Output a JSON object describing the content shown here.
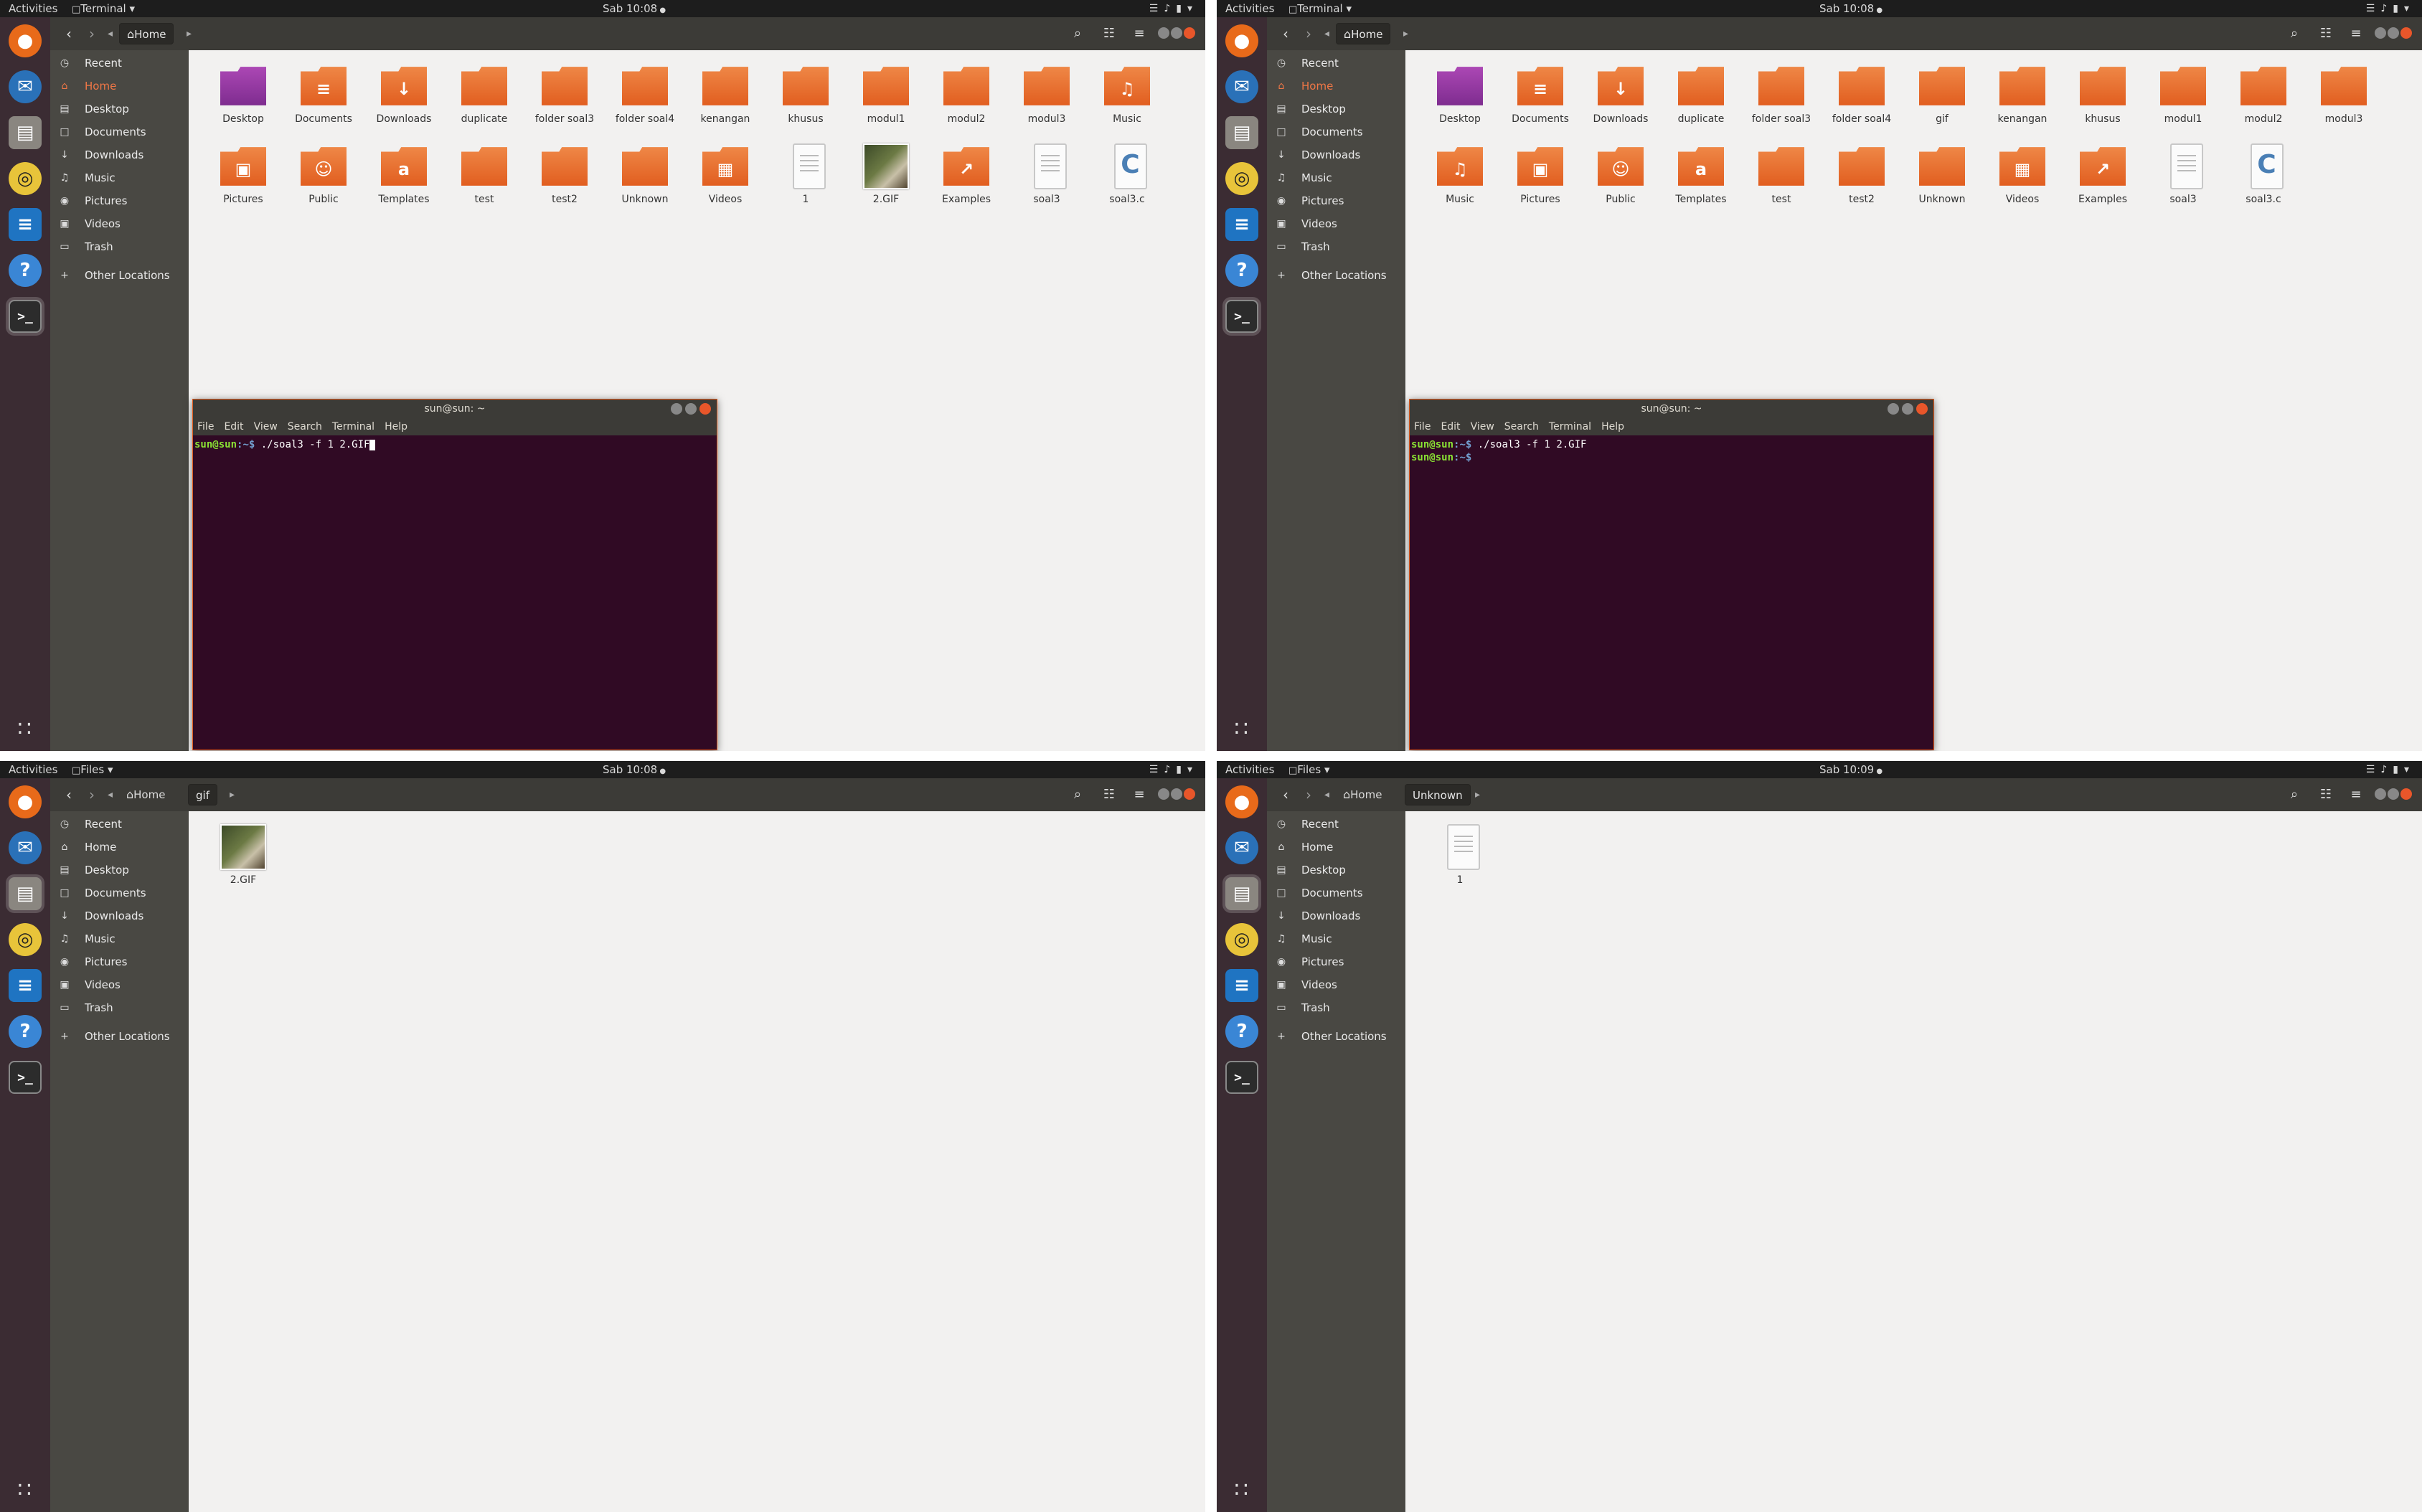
{
  "quadrants": [
    {
      "topbar": {
        "activities": "Activities",
        "app": "Terminal",
        "clock": "Sab 10:08"
      },
      "breadcrumbs": [
        "Home"
      ],
      "sidebar": [
        "Recent",
        "Home",
        "Desktop",
        "Documents",
        "Downloads",
        "Music",
        "Pictures",
        "Videos",
        "Trash",
        "Other Locations"
      ],
      "files": [
        {
          "name": "Desktop",
          "kind": "folder"
        },
        {
          "name": "Documents",
          "kind": "folder"
        },
        {
          "name": "Downloads",
          "kind": "folder"
        },
        {
          "name": "duplicate",
          "kind": "folder"
        },
        {
          "name": "folder soal3",
          "kind": "folder"
        },
        {
          "name": "folder soal4",
          "kind": "folder"
        },
        {
          "name": "kenangan",
          "kind": "folder"
        },
        {
          "name": "khusus",
          "kind": "folder"
        },
        {
          "name": "modul1",
          "kind": "folder"
        },
        {
          "name": "modul2",
          "kind": "folder"
        },
        {
          "name": "modul3",
          "kind": "folder"
        },
        {
          "name": "Music",
          "kind": "folder"
        },
        {
          "name": "Pictures",
          "kind": "folder"
        },
        {
          "name": "Public",
          "kind": "folder"
        },
        {
          "name": "Templates",
          "kind": "folder"
        },
        {
          "name": "test",
          "kind": "folder"
        },
        {
          "name": "test2",
          "kind": "folder"
        },
        {
          "name": "Unknown",
          "kind": "folder"
        },
        {
          "name": "Videos",
          "kind": "folder"
        },
        {
          "name": "1",
          "kind": "file"
        },
        {
          "name": "2.GIF",
          "kind": "image"
        },
        {
          "name": "Examples",
          "kind": "folder"
        },
        {
          "name": "soal3",
          "kind": "file"
        },
        {
          "name": "soal3.c",
          "kind": "cfile"
        }
      ],
      "terminal": {
        "title": "sun@sun: ~",
        "menu": [
          "File",
          "Edit",
          "View",
          "Search",
          "Terminal",
          "Help"
        ],
        "lines": [
          {
            "prompt": "sun@sun",
            "path": ":~$",
            "cmd": " ./soal3 -f 1 2.GIF",
            "cursor": true
          }
        ]
      }
    },
    {
      "topbar": {
        "activities": "Activities",
        "app": "Terminal",
        "clock": "Sab 10:08"
      },
      "breadcrumbs": [
        "Home"
      ],
      "sidebar": [
        "Recent",
        "Home",
        "Desktop",
        "Documents",
        "Downloads",
        "Music",
        "Pictures",
        "Videos",
        "Trash",
        "Other Locations"
      ],
      "files": [
        {
          "name": "Desktop",
          "kind": "folder"
        },
        {
          "name": "Documents",
          "kind": "folder"
        },
        {
          "name": "Downloads",
          "kind": "folder"
        },
        {
          "name": "duplicate",
          "kind": "folder"
        },
        {
          "name": "folder soal3",
          "kind": "folder"
        },
        {
          "name": "folder soal4",
          "kind": "folder"
        },
        {
          "name": "gif",
          "kind": "folder"
        },
        {
          "name": "kenangan",
          "kind": "folder"
        },
        {
          "name": "khusus",
          "kind": "folder"
        },
        {
          "name": "modul1",
          "kind": "folder"
        },
        {
          "name": "modul2",
          "kind": "folder"
        },
        {
          "name": "modul3",
          "kind": "folder"
        },
        {
          "name": "Music",
          "kind": "folder"
        },
        {
          "name": "Pictures",
          "kind": "folder"
        },
        {
          "name": "Public",
          "kind": "folder"
        },
        {
          "name": "Templates",
          "kind": "folder"
        },
        {
          "name": "test",
          "kind": "folder"
        },
        {
          "name": "test2",
          "kind": "folder"
        },
        {
          "name": "Unknown",
          "kind": "folder"
        },
        {
          "name": "Videos",
          "kind": "folder"
        },
        {
          "name": "Examples",
          "kind": "folder"
        },
        {
          "name": "soal3",
          "kind": "file"
        },
        {
          "name": "soal3.c",
          "kind": "cfile"
        }
      ],
      "terminal": {
        "title": "sun@sun: ~",
        "menu": [
          "File",
          "Edit",
          "View",
          "Search",
          "Terminal",
          "Help"
        ],
        "lines": [
          {
            "prompt": "sun@sun",
            "path": ":~$",
            "cmd": " ./soal3 -f 1 2.GIF",
            "cursor": false
          },
          {
            "prompt": "sun@sun",
            "path": ":~$",
            "cmd": " ",
            "cursor": false
          }
        ]
      }
    },
    {
      "topbar": {
        "activities": "Activities",
        "app": "Files",
        "clock": "Sab 10:08"
      },
      "breadcrumbs": [
        "Home",
        "gif"
      ],
      "sidebar": [
        "Recent",
        "Home",
        "Desktop",
        "Documents",
        "Downloads",
        "Music",
        "Pictures",
        "Videos",
        "Trash",
        "Other Locations"
      ],
      "files": [
        {
          "name": "2.GIF",
          "kind": "image"
        }
      ]
    },
    {
      "topbar": {
        "activities": "Activities",
        "app": "Files",
        "clock": "Sab 10:09"
      },
      "breadcrumbs": [
        "Home",
        "Unknown"
      ],
      "sidebar": [
        "Recent",
        "Home",
        "Desktop",
        "Documents",
        "Downloads",
        "Music",
        "Pictures",
        "Videos",
        "Trash",
        "Other Locations"
      ],
      "files": [
        {
          "name": "1",
          "kind": "file"
        }
      ]
    }
  ]
}
